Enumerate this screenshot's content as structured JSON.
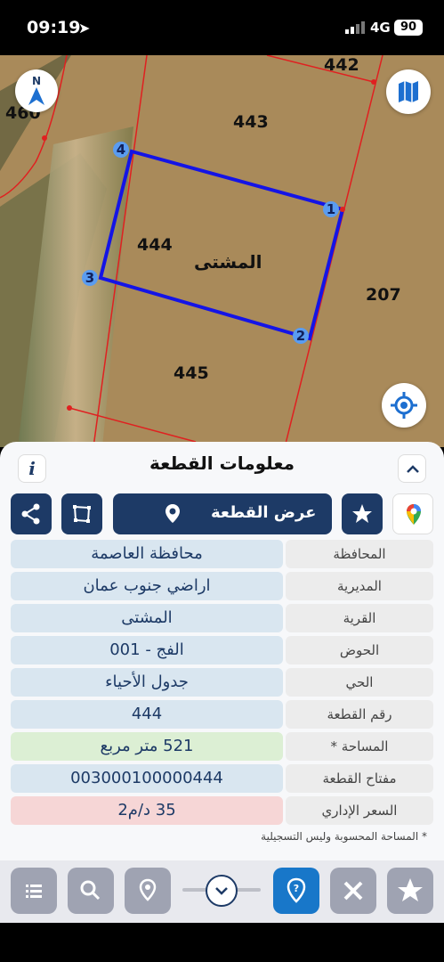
{
  "status_bar": {
    "time": "09:19",
    "network": "4G",
    "battery": "90"
  },
  "map": {
    "parcel_labels": {
      "p442": "442",
      "p443": "443",
      "p444": "444",
      "p445": "445",
      "p207": "207",
      "p460": "460"
    },
    "area_name": "المشتى",
    "vertices": [
      "1",
      "2",
      "3",
      "4"
    ],
    "compass_letter": "N",
    "colors": {
      "boundary": "#e02020",
      "highlight": "#1414e6",
      "vertex_fill": "#5a9cf0"
    }
  },
  "sheet": {
    "title": "معلومات القطعة",
    "info_label": "i",
    "show_parcel_label": "عرض القطعة",
    "rows": [
      {
        "key": "المحافظة",
        "value": "محافظة العاصمة",
        "style": "normal"
      },
      {
        "key": "المديرية",
        "value": "اراضي جنوب عمان",
        "style": "normal"
      },
      {
        "key": "القرية",
        "value": "المشتى",
        "style": "normal"
      },
      {
        "key": "الحوض",
        "value": "الفج - 001",
        "style": "normal"
      },
      {
        "key": "الحي",
        "value": "جدول الأحياء",
        "style": "normal"
      },
      {
        "key": "رقم القطعة",
        "value": "444",
        "style": "normal"
      },
      {
        "key": "المساحة *",
        "value": "521  متر مربع",
        "style": "green"
      },
      {
        "key": "مفتاح القطعة",
        "value": "003000100000444",
        "style": "normal"
      },
      {
        "key": "السعر الإداري",
        "value": "35 د/م2",
        "style": "red"
      }
    ],
    "note": "* المساحة المحسوبة وليس التسجيلية"
  },
  "colors": {
    "primary": "#1d3a66",
    "accent_blue": "#1877c9",
    "gray_button": "#9fa3b2"
  }
}
